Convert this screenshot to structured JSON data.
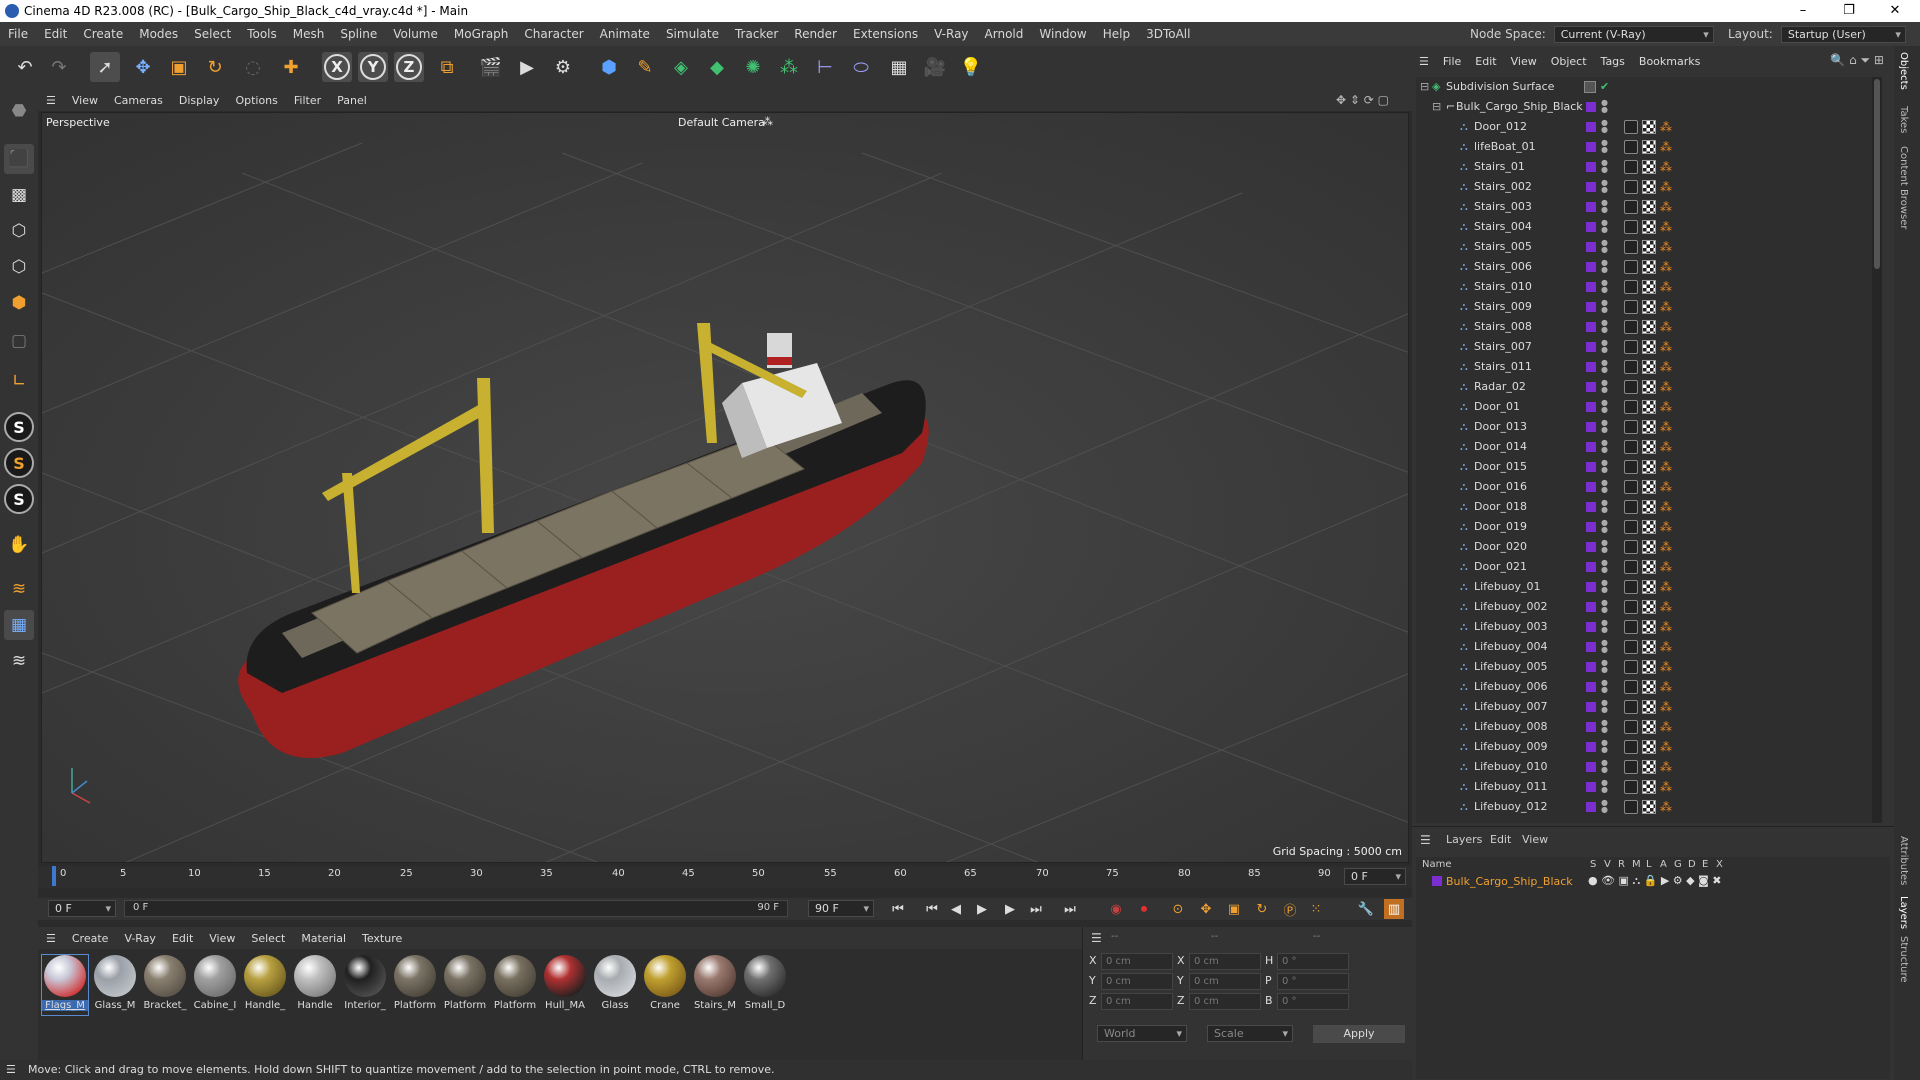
{
  "window": {
    "title": "Cinema 4D R23.008 (RC) - [Bulk_Cargo_Ship_Black_c4d_vray.c4d *] - Main",
    "controls": [
      "–",
      "❐",
      "✕"
    ]
  },
  "menubar": {
    "items": [
      "File",
      "Edit",
      "Create",
      "Modes",
      "Select",
      "Tools",
      "Mesh",
      "Spline",
      "Volume",
      "MoGraph",
      "Character",
      "Animate",
      "Simulate",
      "Tracker",
      "Render",
      "Extensions",
      "V-Ray",
      "Arnold",
      "Window",
      "Help",
      "3DToAll"
    ],
    "node_space_label": "Node Space:",
    "node_space_value": "Current (V-Ray)",
    "layout_label": "Layout:",
    "layout_value": "Startup (User)"
  },
  "viewport": {
    "menu": [
      "View",
      "Cameras",
      "Display",
      "Options",
      "Filter",
      "Panel"
    ],
    "view_name": "Perspective",
    "camera": "Default Camera",
    "grid_spacing": "Grid Spacing : 5000 cm"
  },
  "timeline": {
    "ticks": [
      "0",
      "5",
      "10",
      "15",
      "20",
      "25",
      "30",
      "35",
      "40",
      "45",
      "50",
      "55",
      "60",
      "65",
      "70",
      "75",
      "80",
      "85",
      "90"
    ],
    "current_frame": "0 F",
    "start_frame": "0 F",
    "range_start": "0 F",
    "range_end": "90 F",
    "end_frame": "90 F"
  },
  "materials": {
    "menu": [
      "Create",
      "V-Ray",
      "Edit",
      "View",
      "Select",
      "Material",
      "Texture"
    ],
    "items": [
      {
        "name": "Flags_M",
        "color": "#c8c8d8",
        "accent": "#d03030"
      },
      {
        "name": "Glass_M",
        "color": "#9aa0a8",
        "accent": "#c0c4c8"
      },
      {
        "name": "Bracket_",
        "color": "#8a8070",
        "accent": "#5a5248"
      },
      {
        "name": "Cabine_I",
        "color": "#a0a0a0",
        "accent": "#707070"
      },
      {
        "name": "Handle_",
        "color": "#b8a040",
        "accent": "#706020"
      },
      {
        "name": "Handle",
        "color": "#c0c0c0",
        "accent": "#808080"
      },
      {
        "name": "Interior_",
        "color": "#202020",
        "accent": "#505050"
      },
      {
        "name": "Platform",
        "color": "#7c7466",
        "accent": "#4a443a"
      },
      {
        "name": "Platform",
        "color": "#7a7264",
        "accent": "#4a443a"
      },
      {
        "name": "Platform",
        "color": "#787060",
        "accent": "#4a443a"
      },
      {
        "name": "Hull_MA",
        "color": "#b03030",
        "accent": "#202020"
      },
      {
        "name": "Glass",
        "color": "#a8acb0",
        "accent": "#d0d4d8"
      },
      {
        "name": "Crane",
        "color": "#c0a030",
        "accent": "#806018"
      },
      {
        "name": "Stairs_M",
        "color": "#9a7a70",
        "accent": "#5a4038"
      },
      {
        "name": "Small_D",
        "color": "#707070",
        "accent": "#303030"
      }
    ]
  },
  "coords": {
    "header": [
      "--",
      "--",
      "--"
    ],
    "rows": [
      {
        "a": "X",
        "av": "0 cm",
        "b": "X",
        "bv": "0 cm",
        "c": "H",
        "cv": "0 °"
      },
      {
        "a": "Y",
        "av": "0 cm",
        "b": "Y",
        "bv": "0 cm",
        "c": "P",
        "cv": "0 °"
      },
      {
        "a": "Z",
        "av": "0 cm",
        "b": "Z",
        "bv": "0 cm",
        "c": "B",
        "cv": "0 °"
      }
    ],
    "space": "World",
    "mode": "Scale",
    "apply": "Apply"
  },
  "status": "Move: Click and drag to move elements. Hold down SHIFT to quantize movement / add to the selection in point mode, CTRL to remove.",
  "objects": {
    "menu": [
      "File",
      "Edit",
      "View",
      "Object",
      "Tags",
      "Bookmarks"
    ],
    "root": "Subdivision Surface",
    "group": "Bulk_Cargo_Ship_Black",
    "items": [
      "Door_012",
      "lifeBoat_01",
      "Stairs_01",
      "Stairs_002",
      "Stairs_003",
      "Stairs_004",
      "Stairs_005",
      "Stairs_006",
      "Stairs_010",
      "Stairs_009",
      "Stairs_008",
      "Stairs_007",
      "Stairs_011",
      "Radar_02",
      "Door_01",
      "Door_013",
      "Door_014",
      "Door_015",
      "Door_016",
      "Door_018",
      "Door_019",
      "Door_020",
      "Door_021",
      "Lifebuoy_01",
      "Lifebuoy_002",
      "Lifebuoy_003",
      "Lifebuoy_004",
      "Lifebuoy_005",
      "Lifebuoy_006",
      "Lifebuoy_007",
      "Lifebuoy_008",
      "Lifebuoy_009",
      "Lifebuoy_010",
      "Lifebuoy_011",
      "Lifebuoy_012"
    ]
  },
  "layers": {
    "menu": [
      "Layers",
      "Edit",
      "View"
    ],
    "columns": [
      "Name",
      "S",
      "V",
      "R",
      "M",
      "L",
      "A",
      "G",
      "D",
      "E",
      "X"
    ],
    "items": [
      {
        "name": "Bulk_Cargo_Ship_Black",
        "color": "#7b2fd0"
      }
    ]
  },
  "side_tabs": [
    "Objects",
    "Takes",
    "Content Browser",
    "Attributes",
    "Layers",
    "Structure"
  ]
}
